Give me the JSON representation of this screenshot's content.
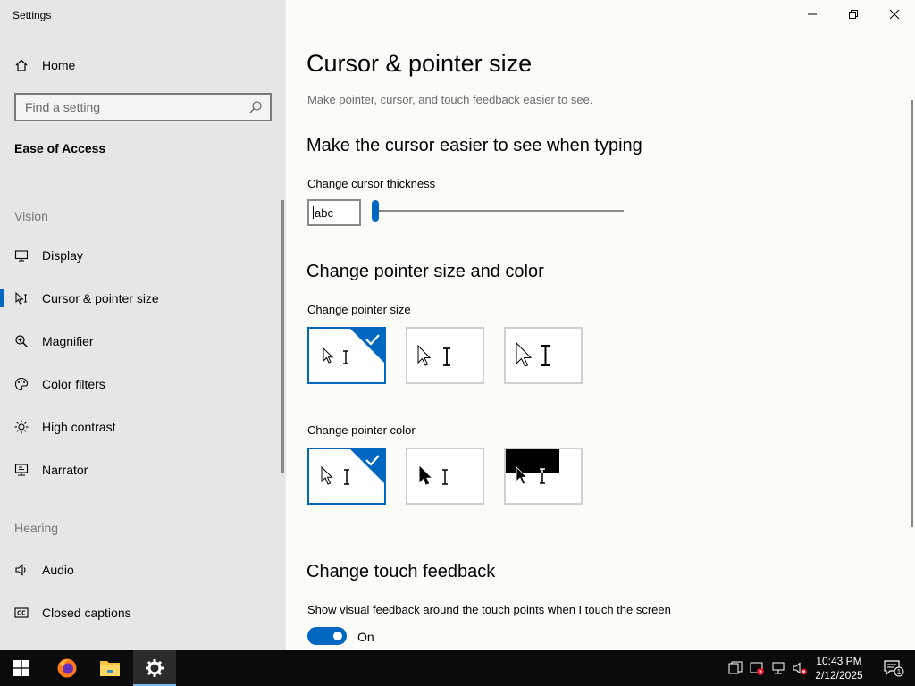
{
  "app_title": "Settings",
  "sidebar": {
    "home_label": "Home",
    "search_placeholder": "Find a setting",
    "section_title": "Ease of Access",
    "groups": {
      "vision": "Vision",
      "hearing": "Hearing"
    },
    "items": [
      {
        "label": "Display",
        "icon": "display-icon"
      },
      {
        "label": "Cursor & pointer size",
        "icon": "cursor-icon",
        "active": true
      },
      {
        "label": "Magnifier",
        "icon": "magnifier-icon"
      },
      {
        "label": "Color filters",
        "icon": "palette-icon"
      },
      {
        "label": "High contrast",
        "icon": "sun-icon"
      },
      {
        "label": "Narrator",
        "icon": "narrator-icon"
      },
      {
        "label": "Audio",
        "icon": "speaker-icon"
      },
      {
        "label": "Closed captions",
        "icon": "cc-icon"
      }
    ]
  },
  "main": {
    "title": "Cursor & pointer size",
    "description": "Make pointer, cursor, and touch feedback easier to see.",
    "cursor_section": {
      "heading": "Make the cursor easier to see when typing",
      "thickness_label": "Change cursor thickness",
      "preview_text": "abc",
      "thickness_value": 1,
      "thickness_max": 20
    },
    "pointer_section": {
      "heading": "Change pointer size and color",
      "size_label": "Change pointer size",
      "sizes_selected": 0,
      "color_label": "Change pointer color",
      "colors_selected": 0
    },
    "touch_section": {
      "heading": "Change touch feedback",
      "feedback_label": "Show visual feedback around the touch points when I touch the screen",
      "toggle_state": "On"
    }
  },
  "taskbar": {
    "time": "10:43 PM",
    "date": "2/12/2025",
    "notification_count": "1"
  },
  "colors": {
    "accent": "#0067c0",
    "sidebar_bg": "#e6e6e6",
    "content_bg": "#fbfbf7",
    "taskbar_bg": "#0b0b0b"
  }
}
